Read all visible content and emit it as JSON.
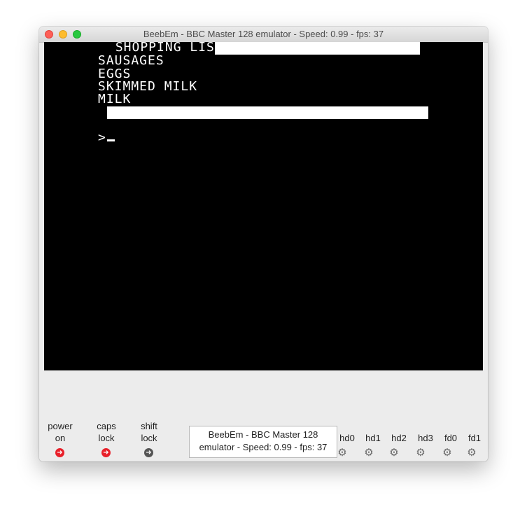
{
  "window": {
    "title": "BeebEm - BBC Master 128 emulator - Speed: 0.99 - fps: 37"
  },
  "screen": {
    "header": " SHOPPING LIST",
    "items": [
      "SAUSAGES",
      "EGGS",
      "SKIMMED MILK",
      "MILK"
    ],
    "prompt": ">"
  },
  "statusbar": {
    "leds": [
      {
        "label_line1": "power",
        "label_line2": "on",
        "state": "on",
        "icon": "arrow-right-icon",
        "color": "#e8202a"
      },
      {
        "label_line1": "caps",
        "label_line2": "lock",
        "state": "on",
        "icon": "arrow-right-icon",
        "color": "#e8202a"
      },
      {
        "label_line1": "shift",
        "label_line2": "lock",
        "state": "off",
        "icon": "arrow-right-icon",
        "color": "#555555"
      }
    ],
    "status_line1": "BeebEm - BBC Master 128",
    "status_line2": "emulator - Speed: 0.99 - fps: 37",
    "drives": [
      {
        "label": "hd0",
        "icon": "gear-icon"
      },
      {
        "label": "hd1",
        "icon": "gear-icon"
      },
      {
        "label": "hd2",
        "icon": "gear-icon"
      },
      {
        "label": "hd3",
        "icon": "gear-icon"
      },
      {
        "label": "fd0",
        "icon": "gear-icon"
      },
      {
        "label": "fd1",
        "icon": "gear-icon"
      }
    ]
  },
  "colors": {
    "screen_bg": "#000000",
    "screen_fg": "#ffffff",
    "led_on": "#e8202a",
    "led_off": "#555555"
  }
}
